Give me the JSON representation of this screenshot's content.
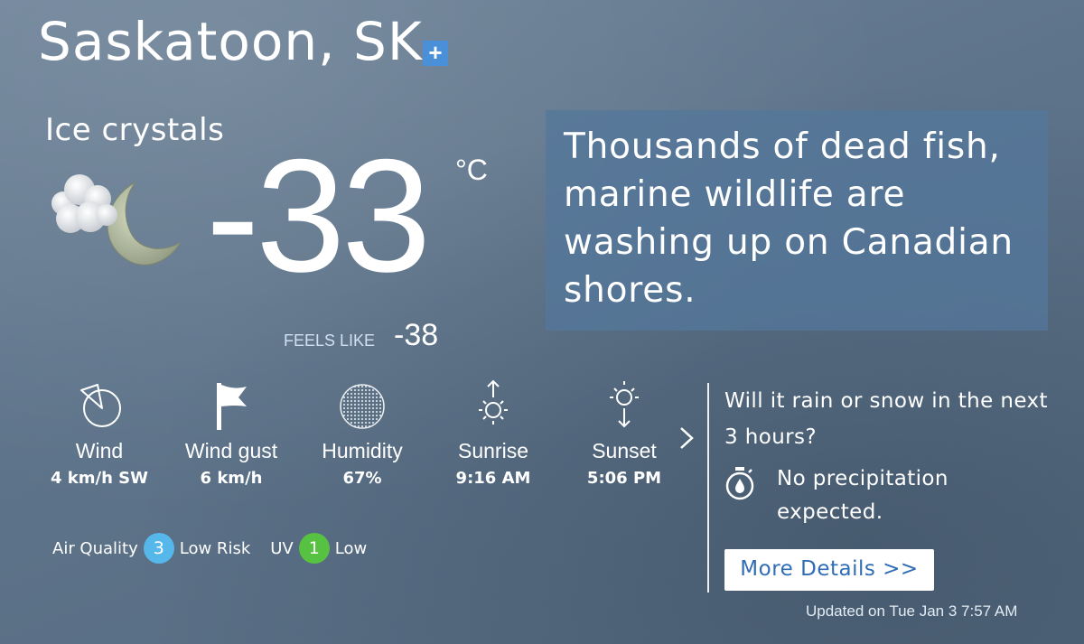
{
  "location": {
    "city": "Saskatoon, SK",
    "add_icon": "plus-icon",
    "add_symbol": "+"
  },
  "current": {
    "condition": "Ice crystals",
    "condition_icon": "cloud-moon-icon",
    "temperature": "-33",
    "unit": "°C",
    "feels_like_label": "FEELS LIKE",
    "feels_like_value": "-38"
  },
  "news": {
    "headline": "Thousands of dead fish, marine wildlife are washing up on Canadian shores."
  },
  "stats": [
    {
      "label": "Wind",
      "value": "4 km/h SW",
      "icon": "wind-direction-icon"
    },
    {
      "label": "Wind gust",
      "value": "6 km/h",
      "icon": "flag-icon"
    },
    {
      "label": "Humidity",
      "value": "67%",
      "icon": "humidity-icon"
    },
    {
      "label": "Sunrise",
      "value": "9:16 AM",
      "icon": "sunrise-icon"
    },
    {
      "label": "Sunset",
      "value": "5:06 PM",
      "icon": "sunset-icon"
    }
  ],
  "air_quality": {
    "label": "Air Quality",
    "value": "3",
    "risk": "Low Risk",
    "color": "#56b7ea"
  },
  "uv": {
    "label": "UV",
    "value": "1",
    "level": "Low",
    "color": "#57c142"
  },
  "precipitation": {
    "question": "Will it rain or snow in the next 3 hours?",
    "answer": "No precipitation expected.",
    "icon": "stopwatch-icon",
    "button_label": "More Details >>"
  },
  "updated": "Updated on Tue Jan 3 7:57 AM",
  "colors": {
    "accent": "#4a90d9",
    "button_text": "#2f6db5",
    "feels_like_label": "#cfe0f1"
  }
}
